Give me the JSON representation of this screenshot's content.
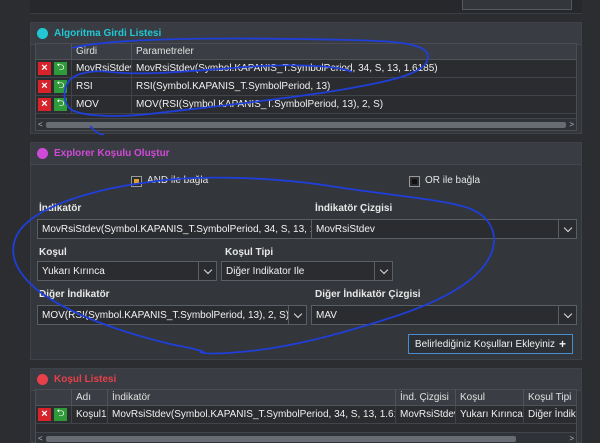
{
  "algo_panel": {
    "title": "Algoritma Girdi Listesi",
    "accent": "#22c7d6",
    "columns": [
      "Girdi",
      "Parametreler"
    ],
    "rows": [
      {
        "input": "MovRsiStdev",
        "params": "MovRsiStdev(Symbol.KAPANIS_T.SymbolPeriod, 34, S, 13, 1.6185)"
      },
      {
        "input": "RSI",
        "params": "RSI(Symbol.KAPANIS_T.SymbolPeriod, 13)"
      },
      {
        "input": "MOV",
        "params": "MOV(RSI(Symbol.KAPANIS_T.SymbolPeriod, 13), 2, S)"
      }
    ]
  },
  "explorer_panel": {
    "title": "Explorer Koşulu Oluştur",
    "accent": "#d04ad8",
    "and_label": "AND ile bağla",
    "or_label": "OR ile bağla",
    "indicator_label": "İndikatör",
    "indicator_value": "MovRsiStdev(Symbol.KAPANIS_T.SymbolPeriod, 34, S, 13, 1.6185)",
    "indicator_line_label": "İndikatör Çizgisi",
    "indicator_line_value": "MovRsiStdev",
    "condition_label": "Koşul",
    "condition_value": "Yukarı Kırınca",
    "condition_type_label": "Koşul Tipi",
    "condition_type_value": "Diğer İndikator İle",
    "other_indicator_label": "Diğer İndikatör",
    "other_indicator_value": "MOV(RSI(Symbol.KAPANIS_T.SymbolPeriod, 13), 2, S)",
    "other_indicator_line_label": "Diğer İndikatör Çizgisi",
    "other_indicator_line_value": "MAV",
    "add_button_label": "Belirlediğiniz Koşulları Ekleyiniz",
    "add_button_icon": "+"
  },
  "condition_panel": {
    "title": "Koşul Listesi",
    "accent": "#e8404a",
    "columns": [
      "Adı",
      "İndikatör",
      "İnd. Çizgisi",
      "Koşul",
      "Koşul Tipi"
    ],
    "rows": [
      {
        "name": "Koşul1",
        "indicator": "MovRsiStdev(Symbol.KAPANIS_T.SymbolPeriod, 34, S, 13, 1.6185)",
        "line": "MovRsiStdev",
        "condition": "Yukarı Kırınca",
        "type": "Diğer İndikat"
      }
    ]
  },
  "icons": {
    "delete": "×",
    "go": "⮌",
    "left_arrow": "<",
    "right_arrow": ">"
  }
}
